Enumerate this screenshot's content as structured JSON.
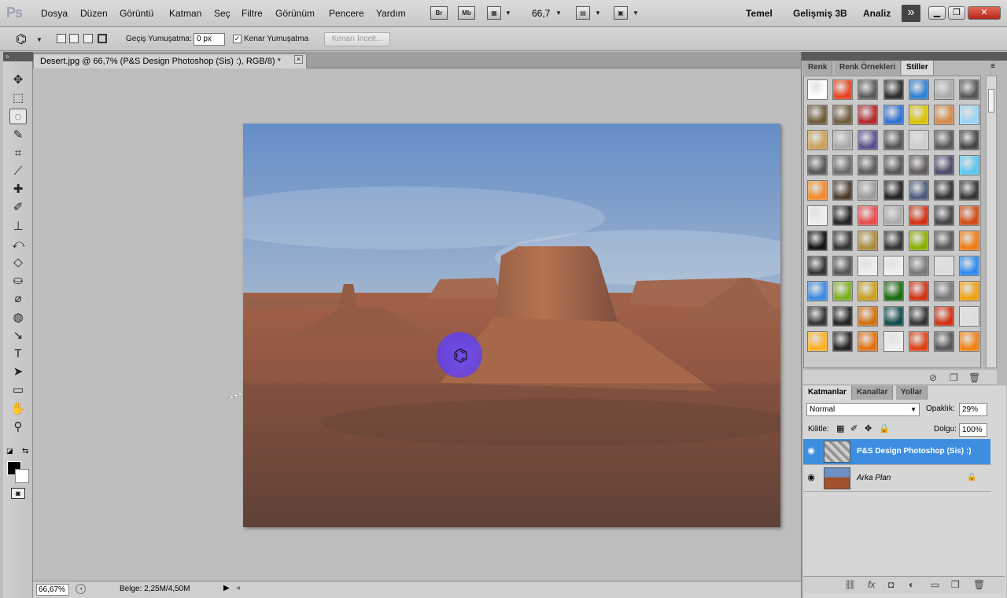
{
  "menubar": {
    "logo": "Ps",
    "items": [
      "Dosya",
      "Düzen",
      "Görüntü",
      "Katman",
      "Seç",
      "Filtre",
      "Görünüm",
      "Pencere",
      "Yardım"
    ],
    "bridge": "Br",
    "minibridge": "Mb",
    "zoom": "66,7",
    "workspaces": [
      "Temel",
      "Gelişmiş 3B",
      "Analiz"
    ],
    "more": "»"
  },
  "options": {
    "feather_label": "Geçiş Yumuşatma:",
    "feather_value": "0 px",
    "antialias_label": "Kenar Yumuşatma",
    "antialias_checked": "✓",
    "refine_edge": "Kenarı İncelt..."
  },
  "document": {
    "tab_title": "Desert.jpg @ 66,7% (P&S Design Photoshop (Sis) :), RGB/8) *",
    "close": "×"
  },
  "toolbox": {
    "collapse": "»",
    "tools": [
      {
        "name": "move-tool",
        "glyph": "✥"
      },
      {
        "name": "marquee-tool",
        "glyph": "⬚"
      },
      {
        "name": "lasso-tool",
        "glyph": "◌",
        "active": true
      },
      {
        "name": "quick-select-tool",
        "glyph": "✎"
      },
      {
        "name": "crop-tool",
        "glyph": "⌗"
      },
      {
        "name": "eyedropper-tool",
        "glyph": "⟋"
      },
      {
        "name": "healing-tool",
        "glyph": "✚"
      },
      {
        "name": "brush-tool",
        "glyph": "✐"
      },
      {
        "name": "stamp-tool",
        "glyph": "⊥"
      },
      {
        "name": "history-brush-tool",
        "glyph": "⤺"
      },
      {
        "name": "eraser-tool",
        "glyph": "◇"
      },
      {
        "name": "paint-bucket-tool",
        "glyph": "⛀"
      },
      {
        "name": "blur-tool",
        "glyph": "⌀"
      },
      {
        "name": "dodge-tool",
        "glyph": "◍"
      },
      {
        "name": "pen-tool",
        "glyph": "↘"
      },
      {
        "name": "type-tool",
        "glyph": "T"
      },
      {
        "name": "path-select-tool",
        "glyph": "➤"
      },
      {
        "name": "shape-tool",
        "glyph": "▭"
      },
      {
        "name": "hand-tool",
        "glyph": "✋"
      },
      {
        "name": "zoom-tool",
        "glyph": "⚲"
      }
    ],
    "quickmask": "◙"
  },
  "status": {
    "zoom": "66,67%",
    "doc_size": "Belge: 2,25M/4,50M"
  },
  "panels": {
    "top_tabs": [
      "Renk",
      "Renk Örnekleri",
      "Stiller"
    ],
    "top_active": 2,
    "layer_tabs": [
      "Katmanlar",
      "Kanallar",
      "Yollar"
    ],
    "layer_active": 0,
    "blend_mode": "Normal",
    "opacity_label": "Opaklık:",
    "opacity_value": "29%",
    "lock_label": "Kilitle:",
    "fill_label": "Dolgu:",
    "fill_value": "100%",
    "layers": [
      {
        "name": "P&S Design Photoshop (Sis) :)",
        "selected": true
      },
      {
        "name": "Arka Plan",
        "selected": false,
        "locked": true
      }
    ]
  },
  "colors": {
    "accent_selected": "#3d8ee0",
    "cursor_glow": "#5a3cff"
  }
}
